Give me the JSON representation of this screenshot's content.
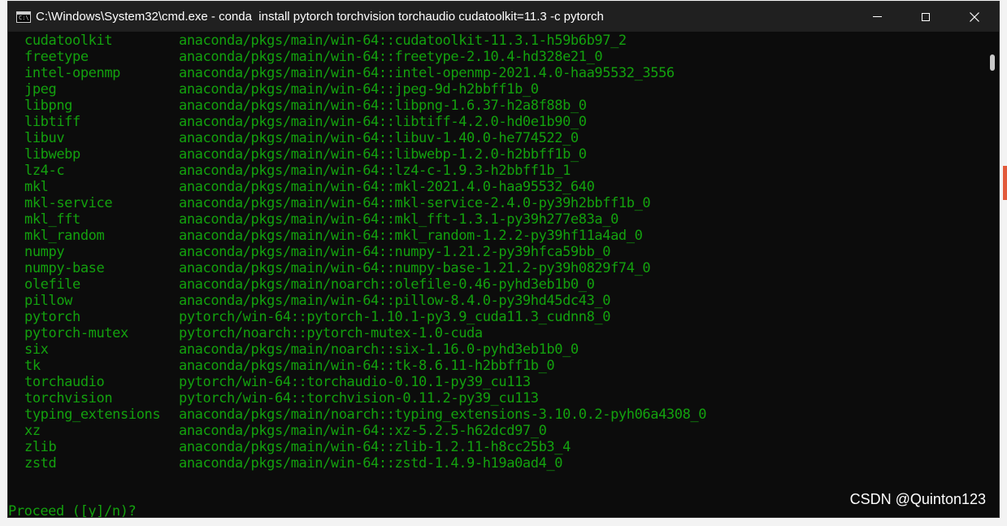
{
  "window": {
    "title": "C:\\Windows\\System32\\cmd.exe - conda  install pytorch torchvision torchaudio cudatoolkit=11.3 -c pytorch",
    "icon_label": "C:\\"
  },
  "packages": [
    {
      "name": "cudatoolkit",
      "source": "anaconda/pkgs/main/win-64::cudatoolkit-11.3.1-h59b6b97_2"
    },
    {
      "name": "freetype",
      "source": "anaconda/pkgs/main/win-64::freetype-2.10.4-hd328e21_0"
    },
    {
      "name": "intel-openmp",
      "source": "anaconda/pkgs/main/win-64::intel-openmp-2021.4.0-haa95532_3556"
    },
    {
      "name": "jpeg",
      "source": "anaconda/pkgs/main/win-64::jpeg-9d-h2bbff1b_0"
    },
    {
      "name": "libpng",
      "source": "anaconda/pkgs/main/win-64::libpng-1.6.37-h2a8f88b_0"
    },
    {
      "name": "libtiff",
      "source": "anaconda/pkgs/main/win-64::libtiff-4.2.0-hd0e1b90_0"
    },
    {
      "name": "libuv",
      "source": "anaconda/pkgs/main/win-64::libuv-1.40.0-he774522_0"
    },
    {
      "name": "libwebp",
      "source": "anaconda/pkgs/main/win-64::libwebp-1.2.0-h2bbff1b_0"
    },
    {
      "name": "lz4-c",
      "source": "anaconda/pkgs/main/win-64::lz4-c-1.9.3-h2bbff1b_1"
    },
    {
      "name": "mkl",
      "source": "anaconda/pkgs/main/win-64::mkl-2021.4.0-haa95532_640"
    },
    {
      "name": "mkl-service",
      "source": "anaconda/pkgs/main/win-64::mkl-service-2.4.0-py39h2bbff1b_0"
    },
    {
      "name": "mkl_fft",
      "source": "anaconda/pkgs/main/win-64::mkl_fft-1.3.1-py39h277e83a_0"
    },
    {
      "name": "mkl_random",
      "source": "anaconda/pkgs/main/win-64::mkl_random-1.2.2-py39hf11a4ad_0"
    },
    {
      "name": "numpy",
      "source": "anaconda/pkgs/main/win-64::numpy-1.21.2-py39hfca59bb_0"
    },
    {
      "name": "numpy-base",
      "source": "anaconda/pkgs/main/win-64::numpy-base-1.21.2-py39h0829f74_0"
    },
    {
      "name": "olefile",
      "source": "anaconda/pkgs/main/noarch::olefile-0.46-pyhd3eb1b0_0"
    },
    {
      "name": "pillow",
      "source": "anaconda/pkgs/main/win-64::pillow-8.4.0-py39hd45dc43_0"
    },
    {
      "name": "pytorch",
      "source": "pytorch/win-64::pytorch-1.10.1-py3.9_cuda11.3_cudnn8_0"
    },
    {
      "name": "pytorch-mutex",
      "source": "pytorch/noarch::pytorch-mutex-1.0-cuda"
    },
    {
      "name": "six",
      "source": "anaconda/pkgs/main/noarch::six-1.16.0-pyhd3eb1b0_0"
    },
    {
      "name": "tk",
      "source": "anaconda/pkgs/main/win-64::tk-8.6.11-h2bbff1b_0"
    },
    {
      "name": "torchaudio",
      "source": "pytorch/win-64::torchaudio-0.10.1-py39_cu113"
    },
    {
      "name": "torchvision",
      "source": "pytorch/win-64::torchvision-0.11.2-py39_cu113"
    },
    {
      "name": "typing_extensions",
      "source": "anaconda/pkgs/main/noarch::typing_extensions-3.10.0.2-pyh06a4308_0"
    },
    {
      "name": "xz",
      "source": "anaconda/pkgs/main/win-64::xz-5.2.5-h62dcd97_0"
    },
    {
      "name": "zlib",
      "source": "anaconda/pkgs/main/win-64::zlib-1.2.11-h8cc25b3_4"
    },
    {
      "name": "zstd",
      "source": "anaconda/pkgs/main/win-64::zstd-1.4.9-h19a0ad4_0"
    }
  ],
  "prompt": "Proceed ([y]/n)?",
  "watermark": "CSDN @Quinton123",
  "colors": {
    "terminal_text": "#13a10e",
    "terminal_bg": "#0c0c0c",
    "titlebar_bg": "#202020"
  }
}
